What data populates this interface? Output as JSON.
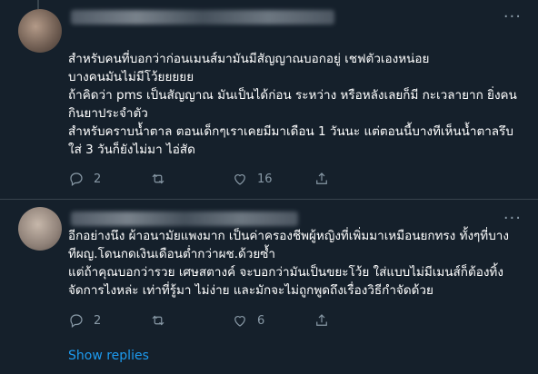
{
  "replies": [
    {
      "text": "สำหรับคนที่บอกว่าก่อนเมนส์มามันมีสัญญาณบอกอยู่ เชฟตัวเองหน่อย\nบางคนมันไม่มีโว้ยยยยย\nถ้าคิดว่า pms เป็นสัญญาณ มันเป็นได้ก่อน ระหว่าง หรือหลังเลยก็มี กะเวลายาก ยิ่งคนกินยาประจำตัว\nสำหรับคราบน้ำตาล ตอนเด็กๆเราเคยมีมาเดือน 1 วันนะ แต่ตอนนี้บางทีเห็นน้ำตาลรึบใส่ 3 วันก็ยังไม่มา ไอ่สัด",
      "replies_count": "2",
      "retweets_count": "",
      "likes_count": "16"
    },
    {
      "text": "อีกอย่างนึง ผ้าอนามัยแพงมาก เป็นค่าครองชีพผู้หญิงที่เพิ่มมาเหมือนยกทรง ทั้งๆที่บางทีผญ.โดนกดเงินเดือนต่ำกว่าผช.ด้วยซ้ำ\nแต่ถ้าคุณบอกว่ารวย เศษสตางค์ จะบอกว่ามันเป็นขยะโว้ย ใส่แบบไม่มีเมนส์ก็ต้องทิ้ง จัดการไงหล่ะ เท่าที่รู้มา ไม่ง่าย และมักจะไม่ถูกพูดถึงเรื่องวิธีกำจัดด้วย",
      "replies_count": "2",
      "retweets_count": "",
      "likes_count": "6"
    }
  ],
  "more_glyph": "···",
  "show_replies": "Show replies",
  "colors": {
    "background": "#15202b",
    "muted": "#8899a6",
    "link": "#1d9bf0",
    "divider": "#38444d"
  }
}
